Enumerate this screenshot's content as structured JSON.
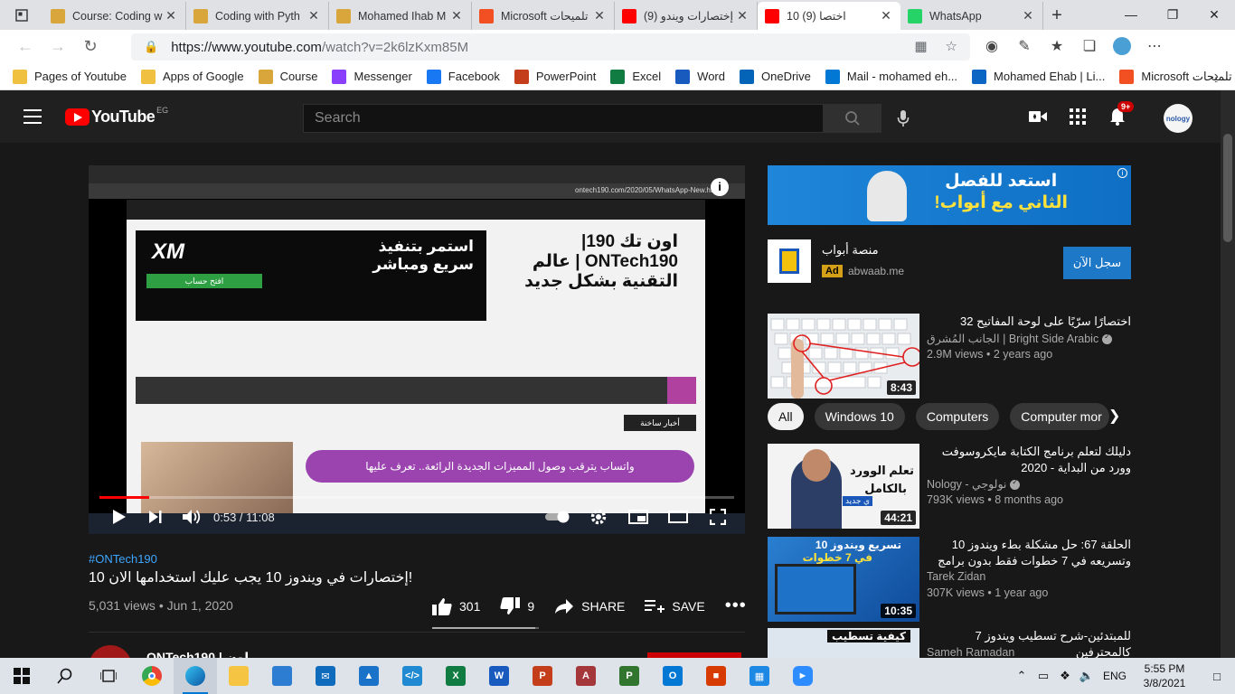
{
  "browser": {
    "tabs": [
      {
        "title": "Course: Coding w",
        "favicon_color": "#d9a63b",
        "active": false
      },
      {
        "title": "Coding with Pyth",
        "favicon_color": "#d9a63b",
        "active": false
      },
      {
        "title": "Mohamed Ihab M",
        "favicon_color": "#d9a63b",
        "active": false
      },
      {
        "title": "Microsoft تلميحات",
        "favicon_color": "#f25022",
        "active": false
      },
      {
        "title": "(9) إختصارات ويندو",
        "favicon_color": "#ff0000",
        "active": false
      },
      {
        "title": "10 اختصا (9)",
        "favicon_color": "#ff0000",
        "active": true
      },
      {
        "title": "WhatsApp",
        "favicon_color": "#25d366",
        "active": false
      }
    ],
    "url_host": "https://www.youtube.com",
    "url_path": "/watch?v=2k6lzKxm85M",
    "bookmarks": [
      {
        "label": "Pages of Youtube",
        "type": "folder",
        "color": "#f0c040"
      },
      {
        "label": "Apps of Google",
        "type": "folder",
        "color": "#f0c040"
      },
      {
        "label": "Course",
        "type": "site",
        "color": "#d9a63b"
      },
      {
        "label": "Messenger",
        "type": "site",
        "color": "#8a3ffc"
      },
      {
        "label": "Facebook",
        "type": "site",
        "color": "#1877f2"
      },
      {
        "label": "PowerPoint",
        "type": "site",
        "color": "#c43e1c"
      },
      {
        "label": "Excel",
        "type": "site",
        "color": "#107c41"
      },
      {
        "label": "Word",
        "type": "site",
        "color": "#185abd"
      },
      {
        "label": "OneDrive",
        "type": "site",
        "color": "#0364b8"
      },
      {
        "label": "Mail - mohamed eh...",
        "type": "site",
        "color": "#0078d4"
      },
      {
        "label": "Mohamed Ehab | Li...",
        "type": "site",
        "color": "#0a66c2"
      },
      {
        "label": "Microsoft تلميحات",
        "type": "site",
        "color": "#f25022"
      }
    ]
  },
  "youtube": {
    "logo_text": "YouTube",
    "country_code": "EG",
    "search_placeholder": "Search",
    "notification_count": "9+",
    "avatar_text": "nology",
    "player": {
      "current_time": "0:53",
      "duration": "11:08",
      "progress_fraction": 0.079,
      "inner_url": "ontech190.com/2020/05/WhatsApp-New.html",
      "site_title_line1": "اون تك 190|",
      "site_title_line2": "ONTech190 | عالم",
      "site_title_line3": "التقنية بشكل جديد",
      "ad_brand": "XM",
      "ad_button": "افتح حساب",
      "ad_headline1": "استمر بتنفيذ",
      "ad_headline2": "سريع ومباشر",
      "news_label": "أخبار ساخنة",
      "banner_text": "واتساب يترقب وصول المميزات الجديدة الرائعة.. تعرف عليها"
    },
    "video": {
      "hashtag": "#ONTech190",
      "title": "!إختصارات في ويندوز 10 يجب عليك استخدامها الان 10",
      "views_date": "5,031 views • Jun 1, 2020",
      "likes": "301",
      "dislikes": "9",
      "like_fraction": 0.97,
      "share_label": "SHARE",
      "save_label": "SAVE",
      "channel_name": "ONTech190 | اون"
    },
    "ad": {
      "banner_line1": "استعد للفصل",
      "banner_line2": "الثاني مع أبواب!",
      "advertiser": "منصة أبواب",
      "ad_tag": "Ad",
      "url": "abwaab.me",
      "cta": "سجل الآن"
    },
    "chips": [
      "All",
      "Windows 10",
      "Computers",
      "Computer mor"
    ],
    "recommendations": [
      {
        "title": "اختصارًا سرّيًا على لوحة المفاتيح 32",
        "channel": "الجانب المُشرق | Bright Side Arabic",
        "meta": "2.9M views • 2 years ago",
        "duration": "8:43",
        "verified": true
      },
      {
        "title": "دليلك لتعلم برنامج الكتابة مايكروسوفت وورد من البداية - 2020",
        "channel": "Nology - نولوجي",
        "meta": "793K views • 8 months ago",
        "duration": "44:21",
        "verified": true
      },
      {
        "title": "الحلقة 67: حل مشكلة بطء ويندوز 10 وتسريعه في 7 خطوات فقط بدون برامج -...",
        "channel": "Tarek Zidan",
        "meta": "307K views • 1 year ago",
        "duration": "10:35",
        "verified": false
      },
      {
        "title": "للمبتدئين-شرح تسطيب ويندوز 7 كالمحترفين",
        "channel": "Sameh Ramadan",
        "meta": "",
        "duration": "",
        "verified": false
      }
    ],
    "thumb_texts": {
      "word_line1": "تعلم الوورد",
      "word_line2": "بالكامل",
      "word_badge": "ي جديد",
      "win_line1": "تسريع ويندوز 10",
      "win_line2": "في 7 خطوات",
      "install": "كيفية تسطيب"
    }
  },
  "taskbar": {
    "language": "ENG",
    "time": "5:55 PM",
    "date": "3/8/2021"
  }
}
